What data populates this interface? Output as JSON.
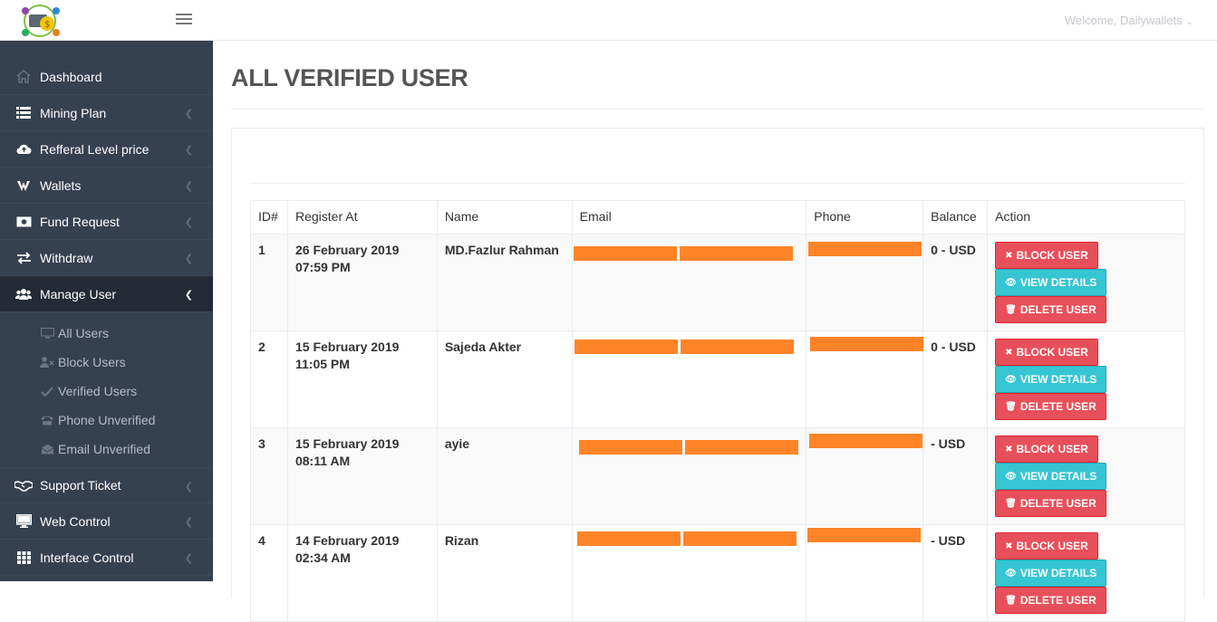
{
  "header": {
    "welcome_text": "Welcome, Dailywallets"
  },
  "sidebar": {
    "items": [
      {
        "label": "Dashboard",
        "icon": "home-icon"
      },
      {
        "label": "Mining Plan",
        "icon": "list-icon"
      },
      {
        "label": "Refferal Level price",
        "icon": "cloud-upload-icon"
      },
      {
        "label": "Wallets",
        "icon": "wallet-icon"
      },
      {
        "label": "Fund Request",
        "icon": "money-icon"
      },
      {
        "label": "Withdraw",
        "icon": "exchange-icon"
      },
      {
        "label": "Manage User",
        "icon": "users-icon"
      }
    ],
    "submenu": [
      {
        "label": "All Users",
        "icon": "desktop-icon"
      },
      {
        "label": "Block Users",
        "icon": "user-times-icon"
      },
      {
        "label": "Verified Users",
        "icon": "check-icon"
      },
      {
        "label": "Phone Unverified",
        "icon": "phone-icon"
      },
      {
        "label": "Email Unverified",
        "icon": "envelope-icon"
      }
    ],
    "bottom_items": [
      {
        "label": "Support Ticket",
        "icon": "handshake-icon"
      },
      {
        "label": "Web Control",
        "icon": "desktop-icon"
      },
      {
        "label": "Interface Control",
        "icon": "grid-icon"
      }
    ]
  },
  "page": {
    "title": "ALL VERIFIED USER"
  },
  "table": {
    "headers": [
      "ID#",
      "Register At",
      "Name",
      "Email",
      "Phone",
      "Balance",
      "Action"
    ],
    "rows": [
      {
        "id": "1",
        "date": "26 February 2019",
        "time": "07:59 PM",
        "name": "MD.Fazlur Rahman",
        "balance": "0 - USD"
      },
      {
        "id": "2",
        "date": "15 February 2019",
        "time": "11:05 PM",
        "name": "Sajeda Akter",
        "balance": "0 - USD"
      },
      {
        "id": "3",
        "date": "15 February 2019",
        "time": "08:11 AM",
        "name": "ayie",
        "balance": "- USD"
      },
      {
        "id": "4",
        "date": "14 February 2019",
        "time": "02:34 AM",
        "name": "Rizan",
        "balance": "- USD"
      }
    ],
    "actions": {
      "block": "BLOCK USER",
      "view": "VIEW DETAILS",
      "delete": "DELETE USER"
    }
  },
  "colors": {
    "sidebar_bg": "#364150",
    "active_bg": "#222b36",
    "red_button": "#e7505a",
    "cyan_button": "#36c6d3",
    "redaction": "#ff8427"
  }
}
